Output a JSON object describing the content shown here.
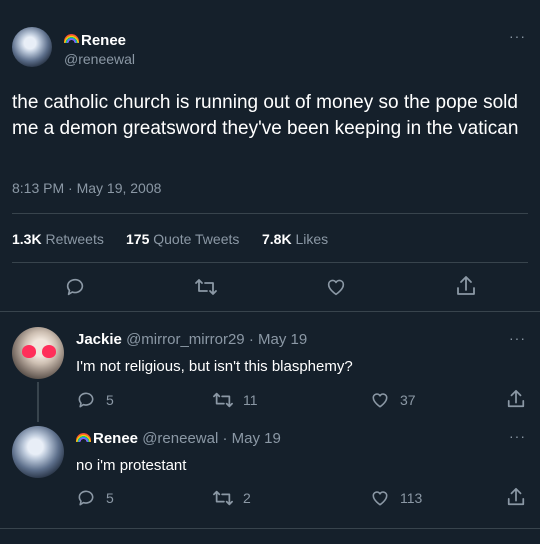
{
  "main_tweet": {
    "display_name": "Renee",
    "handle": "@reneewal",
    "text": "the catholic church is running out of money so the pope sold me a demon greatsword they've been keeping in the vatican",
    "timestamp": "8:13 PM · May 19, 2008",
    "more": "···",
    "stats": {
      "retweets_value": "1.3K",
      "retweets_label": "Retweets",
      "quotes_value": "175",
      "quotes_label": "Quote Tweets",
      "likes_value": "7.8K",
      "likes_label": "Likes"
    }
  },
  "replies": [
    {
      "display_name": "Jackie",
      "handle": "@mirror_mirror29",
      "date": "· May 19",
      "text": "I'm not religious, but isn't this blasphemy?",
      "replies": "5",
      "retweets": "11",
      "likes": "37",
      "more": "···"
    },
    {
      "display_name": "Renee",
      "handle": "@reneewal",
      "date": "· May 19",
      "text": "no i'm protestant",
      "replies": "5",
      "retweets": "2",
      "likes": "113",
      "more": "···"
    }
  ],
  "colors": {
    "background": "#15202b",
    "muted": "#8b98a5",
    "divider": "#38444d"
  },
  "icons": [
    "reply-icon",
    "retweet-icon",
    "like-icon",
    "share-icon",
    "more-icon",
    "rainbow-flag-icon"
  ]
}
